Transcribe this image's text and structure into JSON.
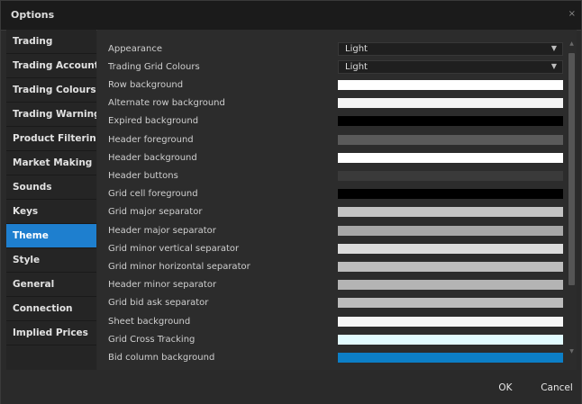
{
  "window": {
    "title": "Options",
    "close_glyph": "×"
  },
  "sidebar": {
    "active": "Theme",
    "items": [
      {
        "label": "Trading"
      },
      {
        "label": "Trading Accounts"
      },
      {
        "label": "Trading Colours"
      },
      {
        "label": "Trading Warnings"
      },
      {
        "label": "Product Filtering"
      },
      {
        "label": "Market Making"
      },
      {
        "label": "Sounds"
      },
      {
        "label": "Keys"
      },
      {
        "label": "Theme"
      },
      {
        "label": "Style"
      },
      {
        "label": "General"
      },
      {
        "label": "Connection"
      },
      {
        "label": "Implied Prices"
      }
    ]
  },
  "theme": {
    "appearance": {
      "label": "Appearance",
      "value": "Light"
    },
    "grid_colours": {
      "label": "Trading Grid Colours",
      "value": "Light"
    },
    "rows": [
      {
        "label": "Row background",
        "color": "#ffffff"
      },
      {
        "label": "Alternate row background",
        "color": "#f4f4f4"
      },
      {
        "label": "Expired background",
        "color": "#000000"
      },
      {
        "label": "Header foreground",
        "color": "#5a5a5a"
      },
      {
        "label": "Header background",
        "color": "#ffffff"
      },
      {
        "label": "Header buttons",
        "color": "#3a3a3a"
      },
      {
        "label": "Grid cell foreground",
        "color": "#000000"
      },
      {
        "label": "Grid major separator",
        "color": "#c3c3c3"
      },
      {
        "label": "Header major separator",
        "color": "#a7a7a7"
      },
      {
        "label": "Grid minor vertical separator",
        "color": "#dcdcdc"
      },
      {
        "label": "Grid minor horizontal separator",
        "color": "#bdbdbd"
      },
      {
        "label": "Header minor separator",
        "color": "#b4b4b4"
      },
      {
        "label": "Grid bid ask separator",
        "color": "#bcbcbc"
      },
      {
        "label": "Sheet background",
        "color": "#f7f7f7"
      },
      {
        "label": "Grid Cross Tracking",
        "color": "#e2fbff"
      },
      {
        "label": "Bid column background",
        "color": "#0c7fc7"
      }
    ]
  },
  "footer": {
    "ok_label": "OK",
    "cancel_label": "Cancel"
  },
  "scrollbar": {
    "up_glyph": "▲",
    "down_glyph": "▼"
  },
  "accent_color": "#1e7fcf"
}
